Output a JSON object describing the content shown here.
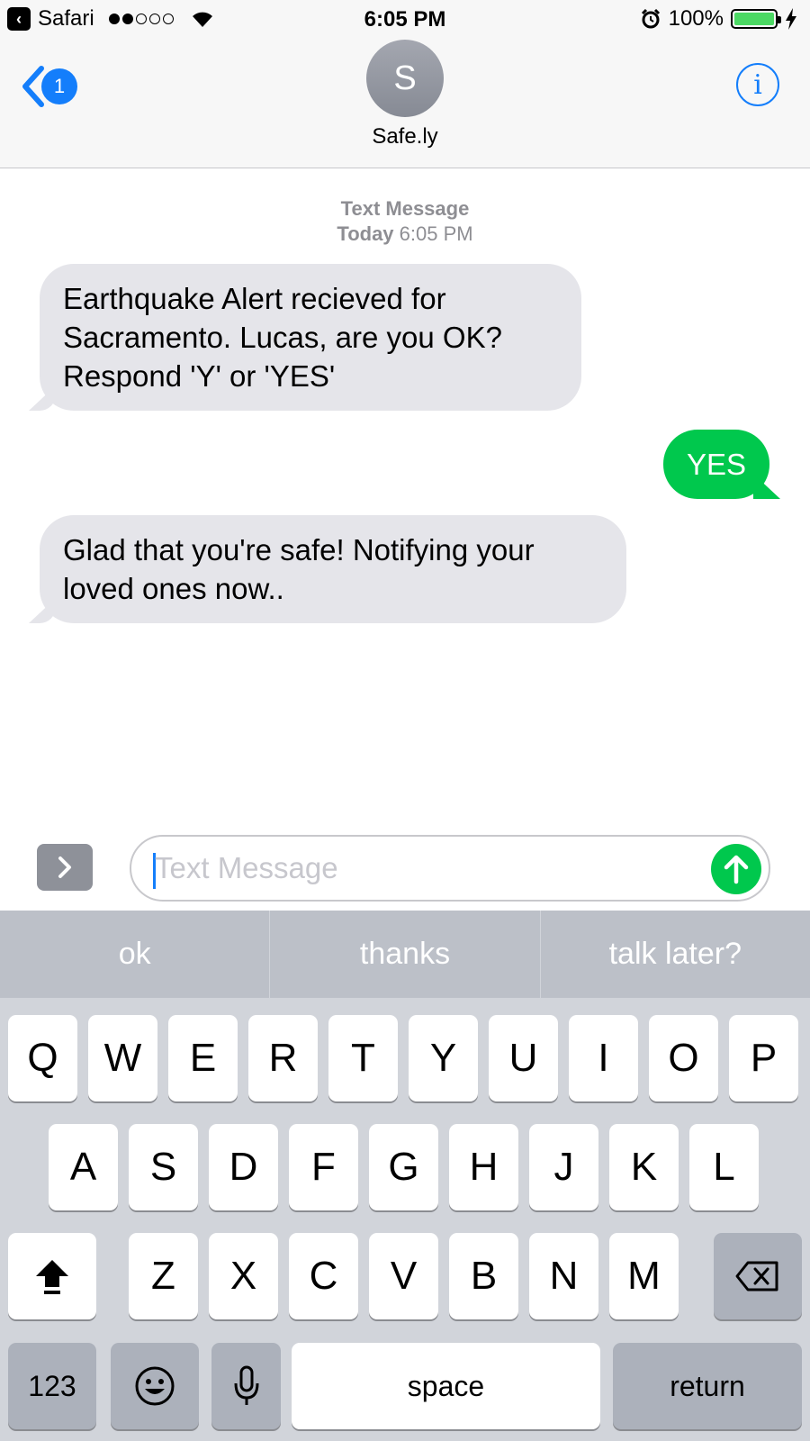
{
  "status_bar": {
    "back_app": "Safari",
    "time": "6:05 PM",
    "battery": "100%",
    "battery_level": 1.0,
    "signal_bars_filled": 2,
    "signal_bars_total": 5
  },
  "header": {
    "back_badge": "1",
    "avatar_initial": "S",
    "contact_name": "Safe.ly",
    "info_glyph": "i"
  },
  "thread": {
    "service": "Text Message",
    "day": "Today",
    "time": "6:05 PM",
    "messages": [
      {
        "direction": "incoming",
        "text": "Earthquake Alert recieved for Sacramento. Lucas, are you OK? Respond 'Y' or 'YES'"
      },
      {
        "direction": "outgoing",
        "text": "YES"
      },
      {
        "direction": "incoming",
        "text": "Glad that you're safe! Notifying your loved ones now.."
      }
    ]
  },
  "compose": {
    "placeholder": "Text Message"
  },
  "keyboard": {
    "suggestions": [
      "ok",
      "thanks",
      "talk later?"
    ],
    "row1": [
      "Q",
      "W",
      "E",
      "R",
      "T",
      "Y",
      "U",
      "I",
      "O",
      "P"
    ],
    "row2": [
      "A",
      "S",
      "D",
      "F",
      "G",
      "H",
      "J",
      "K",
      "L"
    ],
    "row3": [
      "Z",
      "X",
      "C",
      "V",
      "B",
      "N",
      "M"
    ],
    "numbers_label": "123",
    "space_label": "space",
    "return_label": "return"
  },
  "colors": {
    "accent": "#147efb",
    "outgoing_bubble": "#00c84d",
    "incoming_bubble": "#e5e5ea",
    "battery": "#4cd964"
  }
}
